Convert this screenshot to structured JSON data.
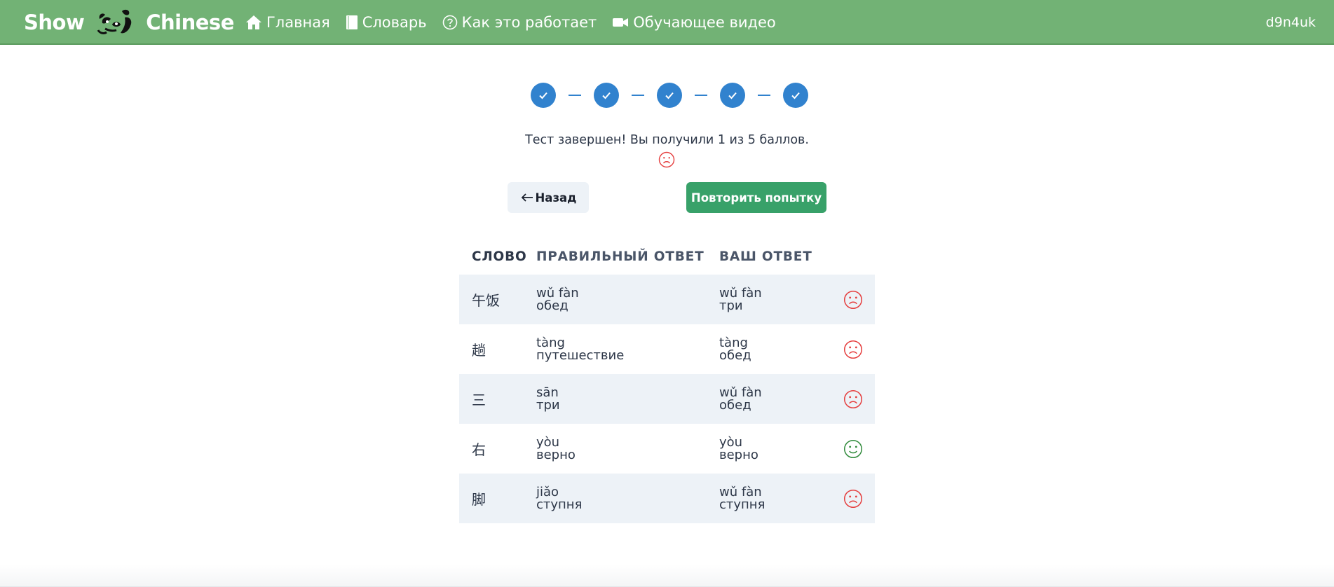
{
  "header": {
    "brand_left": "Show",
    "brand_right": "Chinese",
    "nav": [
      {
        "label": "Главная",
        "icon": "home-icon"
      },
      {
        "label": "Словарь",
        "icon": "book-icon"
      },
      {
        "label": "Как это работает",
        "icon": "question-circle-icon"
      },
      {
        "label": "Обучающее видео",
        "icon": "video-camera-icon"
      }
    ],
    "username": "d9n4uk"
  },
  "stepper": {
    "total_steps": 5,
    "completed_steps": 5,
    "color": "#3182ce"
  },
  "result": {
    "message": "Тест завершен! Вы получили 1 из 5 баллов.",
    "score": 1,
    "max_score": 5,
    "face": "sad"
  },
  "buttons": {
    "back_label": "Назад",
    "retry_label": "Повторить попытку"
  },
  "table": {
    "headers": {
      "word": "Слово",
      "correct": "Правильный ответ",
      "yours": "Ваш ответ"
    },
    "rows": [
      {
        "word": "午饭",
        "correct_pinyin": "wǔ fàn",
        "correct_meaning": "обед",
        "your_pinyin": "wǔ fàn",
        "your_meaning": "три",
        "correct": false
      },
      {
        "word": "趟",
        "correct_pinyin": "tàng",
        "correct_meaning": "путешествие",
        "your_pinyin": "tàng",
        "your_meaning": "обед",
        "correct": false
      },
      {
        "word": "三",
        "correct_pinyin": "sān",
        "correct_meaning": "три",
        "your_pinyin": "wǔ fàn",
        "your_meaning": "обед",
        "correct": false
      },
      {
        "word": "右",
        "correct_pinyin": "yòu",
        "correct_meaning": "верно",
        "your_pinyin": "yòu",
        "your_meaning": "верно",
        "correct": true
      },
      {
        "word": "脚",
        "correct_pinyin": "jiǎo",
        "correct_meaning": "ступня",
        "your_pinyin": "wǔ fàn",
        "your_meaning": "ступня",
        "correct": false
      }
    ]
  },
  "colors": {
    "header_bg": "#72b275",
    "primary": "#3182ce",
    "success": "#38a169",
    "sad": "#e53e3e",
    "happy": "#2f8a3a",
    "row_alt": "#edf2f7"
  }
}
